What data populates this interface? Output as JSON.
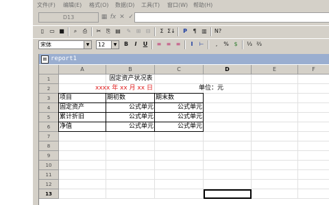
{
  "menu": [
    "文件(F)",
    "编辑(E)",
    "格式(O)",
    "数据(D)",
    "工具(T)",
    "窗口(W)",
    "帮助(H)"
  ],
  "formula_bar": {
    "cell_ref": "D13",
    "buttons": [
      "▦",
      "fx",
      "✕",
      "✓"
    ],
    "value": ""
  },
  "toolbar_standard": [
    "D",
    "🗋",
    "💾",
    "🖨",
    "🔍",
    "✂",
    "⎘",
    "📋",
    "✓",
    "Σ",
    "⊞",
    "Σ↓",
    "Σ↑",
    "P",
    "¶",
    "⅓",
    "N?"
  ],
  "toolbar_format": {
    "font": "宋体",
    "size": "12",
    "buttons": [
      "B",
      "I",
      "U",
      "≡",
      "≡",
      "≡",
      "I",
      "⊢",
      "▫",
      ",",
      "%",
      "$",
      "⅓",
      "⁰⁄₀₀"
    ]
  },
  "document": {
    "title": "report1"
  },
  "columns": [
    "A",
    "B",
    "C",
    "D",
    "E",
    "F"
  ],
  "active_column": "D",
  "rows": [
    "1",
    "2",
    "3",
    "4",
    "5",
    "6",
    "7",
    "8",
    "9",
    "10",
    "11",
    "12",
    "13"
  ],
  "active_row": "13",
  "report": {
    "title": "固定资产状况表",
    "date_line": "xxxx 年 xx 月 xx 日",
    "unit": "单位：元",
    "headers": [
      "项目",
      "期初数",
      "期末数"
    ],
    "items": [
      {
        "label": "固定资产",
        "opening": "公式单元",
        "closing": "公式单元"
      },
      {
        "label": "累计折旧",
        "opening": "公式单元",
        "closing": "公式单元"
      },
      {
        "label": "净值",
        "opening": "公式单元",
        "closing": "公式单元"
      }
    ]
  },
  "colors": {
    "chrome": "#d4d0c8",
    "titlebar": "#9aaed0",
    "date_text": "#e02020"
  }
}
